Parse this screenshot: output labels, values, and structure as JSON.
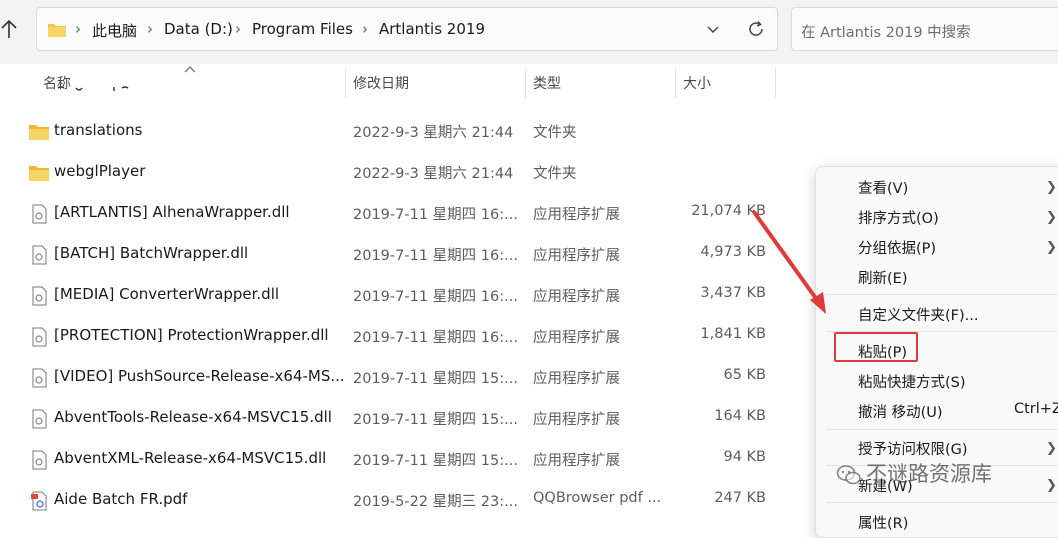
{
  "breadcrumb": {
    "items": [
      "此电脑",
      "Data (D:)",
      "Program Files",
      "Artlantis 2019"
    ]
  },
  "search": {
    "placeholder": "在 Artlantis 2019 中搜索"
  },
  "columns": {
    "name": "名称",
    "date": "修改日期",
    "type": "类型",
    "size": "大小"
  },
  "files": [
    {
      "name": "translations",
      "date": "2022-9-3 星期六 21:44",
      "type": "文件夹",
      "size": "",
      "icon": "folder-icon"
    },
    {
      "name": "webglPlayer",
      "date": "2022-9-3 星期六 21:44",
      "type": "文件夹",
      "size": "",
      "icon": "folder-icon"
    },
    {
      "name": "[ARTLANTIS] AlhenaWrapper.dll",
      "date": "2019-7-11 星期四 16:...",
      "type": "应用程序扩展",
      "size": "21,074 KB",
      "icon": "dll-file-icon"
    },
    {
      "name": "[BATCH] BatchWrapper.dll",
      "date": "2019-7-11 星期四 16:...",
      "type": "应用程序扩展",
      "size": "4,973 KB",
      "icon": "dll-file-icon"
    },
    {
      "name": "[MEDIA] ConverterWrapper.dll",
      "date": "2019-7-11 星期四 16:...",
      "type": "应用程序扩展",
      "size": "3,437 KB",
      "icon": "dll-file-icon"
    },
    {
      "name": "[PROTECTION] ProtectionWrapper.dll",
      "date": "2019-7-11 星期四 16:...",
      "type": "应用程序扩展",
      "size": "1,841 KB",
      "icon": "dll-file-icon"
    },
    {
      "name": "[VIDEO] PushSource-Release-x64-MS...",
      "date": "2019-7-11 星期四 15:...",
      "type": "应用程序扩展",
      "size": "65 KB",
      "icon": "dll-file-icon"
    },
    {
      "name": "AbventTools-Release-x64-MSVC15.dll",
      "date": "2019-7-11 星期四 15:...",
      "type": "应用程序扩展",
      "size": "164 KB",
      "icon": "dll-file-icon"
    },
    {
      "name": "AbventXML-Release-x64-MSVC15.dll",
      "date": "2019-7-11 星期四 15:...",
      "type": "应用程序扩展",
      "size": "94 KB",
      "icon": "dll-file-icon"
    },
    {
      "name": "Aide Batch FR.pdf",
      "date": "2019-5-22 星期三 23:...",
      "type": "QQBrowser pdf ...",
      "size": "247 KB",
      "icon": "pdf-file-icon"
    }
  ],
  "context_menu": {
    "items": [
      {
        "label": "查看(V)",
        "submenu": true
      },
      {
        "label": "排序方式(O)",
        "submenu": true
      },
      {
        "label": "分组依据(P)",
        "submenu": true
      },
      {
        "label": "刷新(E)"
      },
      {
        "label": "自定义文件夹(F)..."
      },
      {
        "label": "粘贴(P)",
        "highlighted": true
      },
      {
        "label": "粘贴快捷方式(S)"
      },
      {
        "label": "撤消 移动(U)",
        "shortcut": "Ctrl+Z"
      },
      {
        "label": "授予访问权限(G)",
        "submenu": true
      },
      {
        "label": "新建(W)",
        "submenu": true
      },
      {
        "label": "属性(R)"
      }
    ]
  },
  "watermark": {
    "text": "不谜路资源库"
  },
  "colors": {
    "highlight": "#e03b3b",
    "folder": "#f4c542"
  }
}
